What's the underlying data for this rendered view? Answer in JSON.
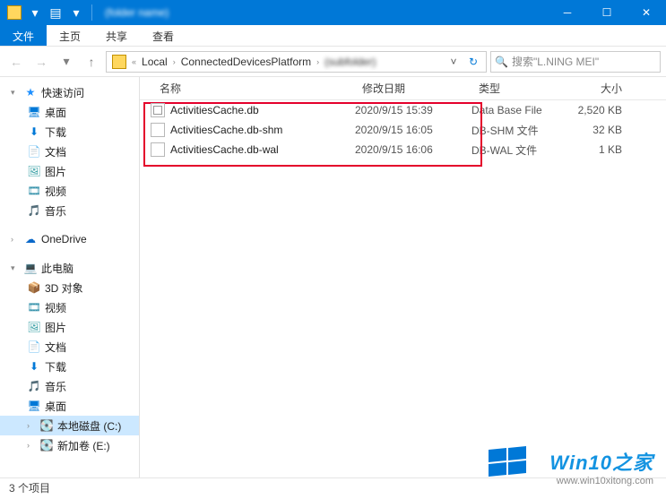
{
  "titlebar": {
    "title": "(folder name)"
  },
  "ribbon": {
    "file": "文件",
    "home": "主页",
    "share": "共享",
    "view": "查看"
  },
  "nav": {
    "crumbs": [
      "Local",
      "ConnectedDevicesPlatform"
    ],
    "crumbs_blur": "(subfolder)",
    "search_placeholder": "搜索\"L.NING MEI\""
  },
  "sidebar": {
    "quick": "快速访问",
    "desktop": "桌面",
    "downloads": "下载",
    "documents": "文档",
    "pictures": "图片",
    "videos": "视频",
    "music": "音乐",
    "onedrive": "OneDrive",
    "thispc": "此电脑",
    "objects3d": "3D 对象",
    "videos2": "视频",
    "pictures2": "图片",
    "documents2": "文档",
    "downloads2": "下载",
    "music2": "音乐",
    "desktop2": "桌面",
    "disk_c": "本地磁盘 (C:)",
    "disk_e": "新加卷 (E:)"
  },
  "columns": {
    "name": "名称",
    "date": "修改日期",
    "type": "类型",
    "size": "大小"
  },
  "files": [
    {
      "name": "ActivitiesCache.db",
      "date": "2020/9/15 15:39",
      "type": "Data Base File",
      "size": "2,520 KB"
    },
    {
      "name": "ActivitiesCache.db-shm",
      "date": "2020/9/15 16:05",
      "type": "DB-SHM 文件",
      "size": "32 KB"
    },
    {
      "name": "ActivitiesCache.db-wal",
      "date": "2020/9/15 16:06",
      "type": "DB-WAL 文件",
      "size": "1 KB"
    }
  ],
  "status": {
    "count": "3 个项目"
  },
  "watermark": {
    "logo": "Win10之家",
    "url": "www.win10xitong.com"
  }
}
